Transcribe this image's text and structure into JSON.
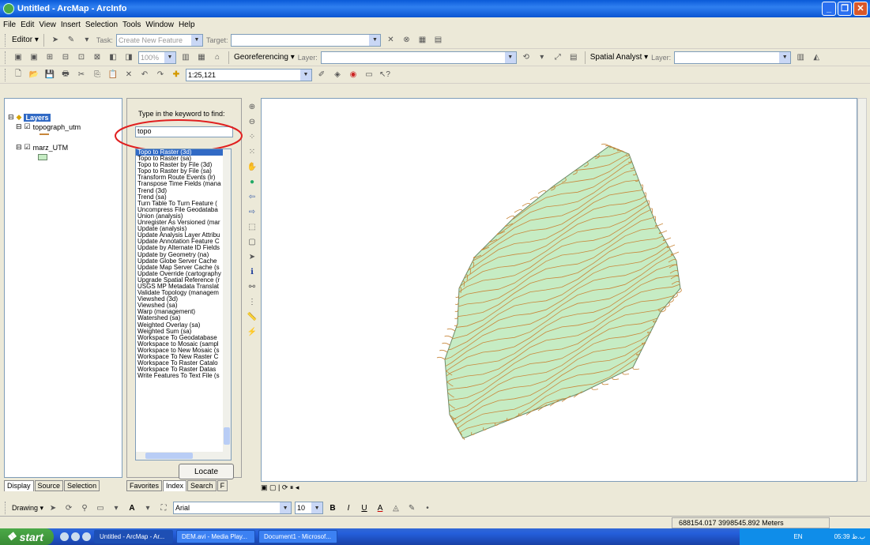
{
  "window": {
    "title": "Untitled - ArcMap - ArcInfo"
  },
  "menu": [
    "File",
    "Edit",
    "View",
    "Insert",
    "Selection",
    "Tools",
    "Window",
    "Help"
  ],
  "editor": {
    "label": "Editor ▾",
    "task_label": "Task:",
    "task_value": "Create New Feature",
    "target_label": "Target:"
  },
  "georef": {
    "label": "Georeferencing ▾",
    "layer_label": "Layer:",
    "zoom": "100%"
  },
  "spatial": {
    "label": "Spatial Analyst ▾",
    "layer_label": "Layer:"
  },
  "standard": {
    "scale": "1:25,121"
  },
  "toc": {
    "root": "Layers",
    "layers": [
      {
        "name": "topograph_utm"
      },
      {
        "name": "marz_UTM"
      }
    ]
  },
  "toc_tabs": [
    "Display",
    "Source",
    "Selection"
  ],
  "search": {
    "prompt": "Type in the keyword to find:",
    "keyword": "topo",
    "results": [
      "Topo to Raster (3d)",
      "Topo to Raster (sa)",
      "Topo to Raster by File (3d)",
      "Topo to Raster by File (sa)",
      "Transform Route Events (lr)",
      "Transpose Time Fields (mana",
      "Trend (3d)",
      "Trend (sa)",
      "Turn Table To Turn Feature (",
      "Uncompress File Geodataba",
      "Union (analysis)",
      "Unregister As Versioned (mar",
      "Update (analysis)",
      "Update Analysis Layer Attribu",
      "Update Annotation Feature C",
      "Update by Alternate ID Fields",
      "Update by Geometry (na)",
      "Update Globe Server Cache",
      "Update Map Server Cache (s",
      "Update Override (cartography",
      "Upgrade Spatial Reference (r",
      "USGS MP Metadata Translat",
      "Validate Topology (managem",
      "Viewshed (3d)",
      "Viewshed (sa)",
      "Warp (management)",
      "Watershed (sa)",
      "Weighted Overlay (sa)",
      "Weighted Sum (sa)",
      "Workspace To Geodatabase",
      "Workspace to Mosaic (sampl",
      "Workspace to New Mosaic (s",
      "Workspace To New Raster C",
      "Workspace To Raster Catalo",
      "Workspace To Raster Datas",
      "Write Features To Text File (s"
    ],
    "locate": "Locate",
    "tabs": [
      "Favorites",
      "Index",
      "Search",
      "F"
    ]
  },
  "drawing": {
    "label": "Drawing ▾",
    "font": "Arial",
    "size": "10"
  },
  "status": {
    "coords": "688154.017  3998545.892 Meters"
  },
  "taskbar": {
    "start": "start",
    "tasks": [
      "Untitled - ArcMap - Ar...",
      "DEM.avi - Media Play...",
      "Document1 - Microsof..."
    ],
    "clock": "05:39 ب.ظ",
    "lang": "EN"
  },
  "colors": {
    "polygon_fill": "#c6ecc4",
    "polygon_edge": "#6a8a6a",
    "contour": "#c8873a",
    "highlight": "#e02020"
  }
}
